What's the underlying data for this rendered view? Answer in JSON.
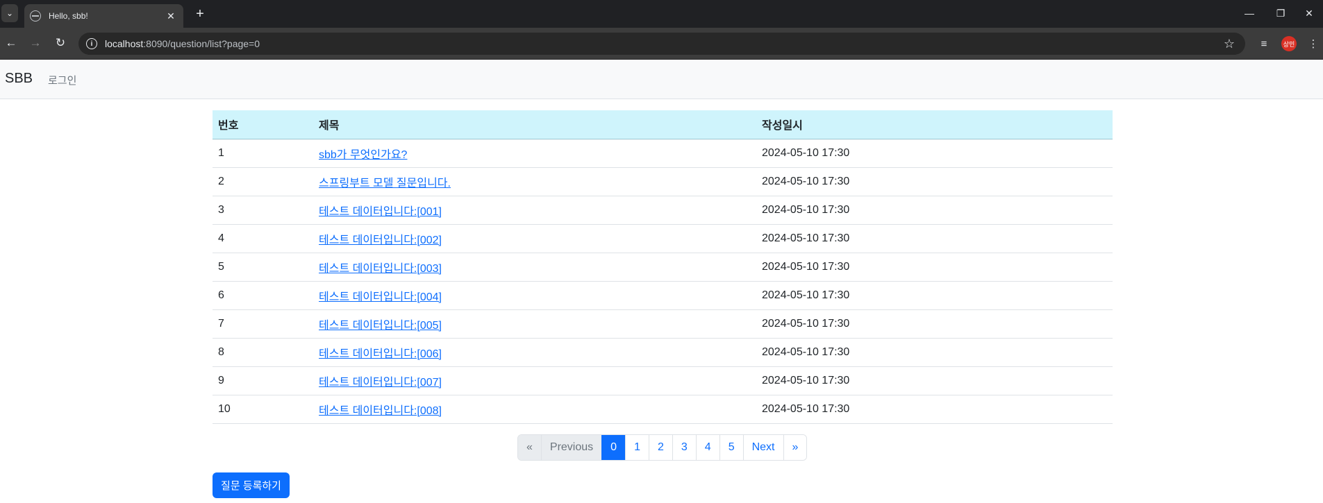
{
  "browser": {
    "tab_title": "Hello, sbb!",
    "url_host": "localhost",
    "url_rest": ":8090/question/list?page=0",
    "profile_label": "상민"
  },
  "navbar": {
    "brand": "SBB",
    "login": "로그인"
  },
  "table": {
    "headers": [
      "번호",
      "제목",
      "작성일시"
    ],
    "rows": [
      {
        "num": "1",
        "subject": "sbb가 무엇인가요?",
        "date": "2024-05-10 17:30"
      },
      {
        "num": "2",
        "subject": "스프링부트 모델 질문입니다.",
        "date": "2024-05-10 17:30"
      },
      {
        "num": "3",
        "subject": "테스트 데이터입니다:[001]",
        "date": "2024-05-10 17:30"
      },
      {
        "num": "4",
        "subject": "테스트 데이터입니다:[002]",
        "date": "2024-05-10 17:30"
      },
      {
        "num": "5",
        "subject": "테스트 데이터입니다:[003]",
        "date": "2024-05-10 17:30"
      },
      {
        "num": "6",
        "subject": "테스트 데이터입니다:[004]",
        "date": "2024-05-10 17:30"
      },
      {
        "num": "7",
        "subject": "테스트 데이터입니다:[005]",
        "date": "2024-05-10 17:30"
      },
      {
        "num": "8",
        "subject": "테스트 데이터입니다:[006]",
        "date": "2024-05-10 17:30"
      },
      {
        "num": "9",
        "subject": "테스트 데이터입니다:[007]",
        "date": "2024-05-10 17:30"
      },
      {
        "num": "10",
        "subject": "테스트 데이터입니다:[008]",
        "date": "2024-05-10 17:30"
      }
    ]
  },
  "pagination": {
    "first": "«",
    "previous": "Previous",
    "pages": [
      "0",
      "1",
      "2",
      "3",
      "4",
      "5"
    ],
    "next": "Next",
    "last": "»"
  },
  "actions": {
    "create_question": "질문 등록하기"
  },
  "colors": {
    "primary": "#0d6efd",
    "table_header_bg": "#cff4fc",
    "navbar_bg": "#f8f9fa"
  }
}
